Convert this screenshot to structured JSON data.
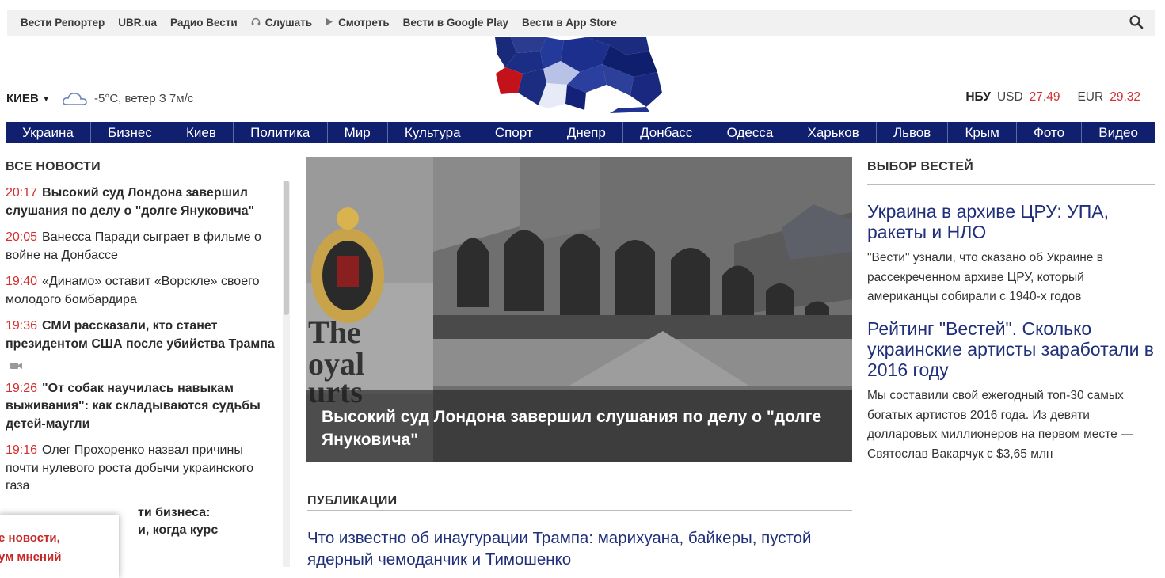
{
  "topbar": {
    "links": [
      {
        "label": "Вести Репортер",
        "icon": ""
      },
      {
        "label": "UBR.ua",
        "icon": ""
      },
      {
        "label": "Радио Вести",
        "icon": ""
      },
      {
        "label": "Слушать",
        "icon": "headphones-icon"
      },
      {
        "label": "Смотреть",
        "icon": "play-icon"
      },
      {
        "label": "Вести в Google Play",
        "icon": ""
      },
      {
        "label": "Вести в App Store",
        "icon": ""
      }
    ],
    "search_icon": "search-icon"
  },
  "header": {
    "city": "КИЕВ",
    "weather_icon": "cloud-icon",
    "weather": "-5°C, ветер З 7м/с",
    "rates": {
      "nbu_label": "НБУ",
      "usd_label": "USD",
      "usd_value": "27.49",
      "eur_label": "EUR",
      "eur_value": "29.32"
    }
  },
  "nav": {
    "items": [
      "Украина",
      "Бизнес",
      "Киев",
      "Политика",
      "Мир",
      "Культура",
      "Спорт",
      "Днепр",
      "Донбасс",
      "Одесса",
      "Харьков",
      "Львов",
      "Крым",
      "Фото",
      "Видео"
    ]
  },
  "all_news": {
    "title": "ВСЕ НОВОСТИ",
    "items": [
      {
        "time": "20:17",
        "text": "Высокий суд Лондона завершил слушания по делу о \"долге Януковича\"",
        "bold": true
      },
      {
        "time": "20:05",
        "text": "Ванесса Паради сыграет в фильме о войне на Донбассе",
        "bold": false
      },
      {
        "time": "19:40",
        "text": "«Динамо» оставит «Ворскле» своего молодого бомбардира",
        "bold": false
      },
      {
        "time": "19:36",
        "text": "СМИ рассказали, кто станет президентом США после убийства Трампа",
        "bold": true,
        "video": true
      },
      {
        "time": "19:26",
        "text": "\"От собак научилась навыкам выживания\": как складываются судьбы детей-маугли",
        "bold": true
      },
      {
        "time": "19:16",
        "text": "Олег Прохоренко назвал причины почти нулевого роста добычи украинского газа",
        "bold": false
      },
      {
        "time": "",
        "text": "ти бизнеса:",
        "bold": true
      },
      {
        "time": "",
        "text": "и, когда курс",
        "bold": true
      }
    ]
  },
  "popup": {
    "line1": "е новости,",
    "line2": "ум мнений"
  },
  "hero": {
    "caption": "Высокий суд Лондона завершил слушания по делу о \"долге Януковича\""
  },
  "publications": {
    "title": "ПУБЛИКАЦИИ",
    "headline": "Что известно об инаугурации Трампа: марихуана, байкеры, пустой ядерный чемоданчик и Тимошенко"
  },
  "editors_pick": {
    "title": "ВЫБОР ВЕСТЕЙ",
    "items": [
      {
        "headline": "Украина в архиве ЦРУ: УПА, ракеты и НЛО",
        "lead": "\"Вести\" узнали, что сказано об Украине в рассекреченном архиве ЦРУ, который американцы собирали с 1940-х годов"
      },
      {
        "headline": "Рейтинг \"Вестей\". Сколько украинские артисты заработали в 2016 году",
        "lead": "Мы составили свой ежегодный топ-30 самых богатых артистов 2016 года. Из девяти долларовых миллионеров на первом месте — Святослав Вакарчук с $3,65 млн"
      }
    ]
  },
  "colors": {
    "nav_bg": "#11206e",
    "accent_red": "#d32f2f",
    "link_blue": "#1f2f7a"
  }
}
